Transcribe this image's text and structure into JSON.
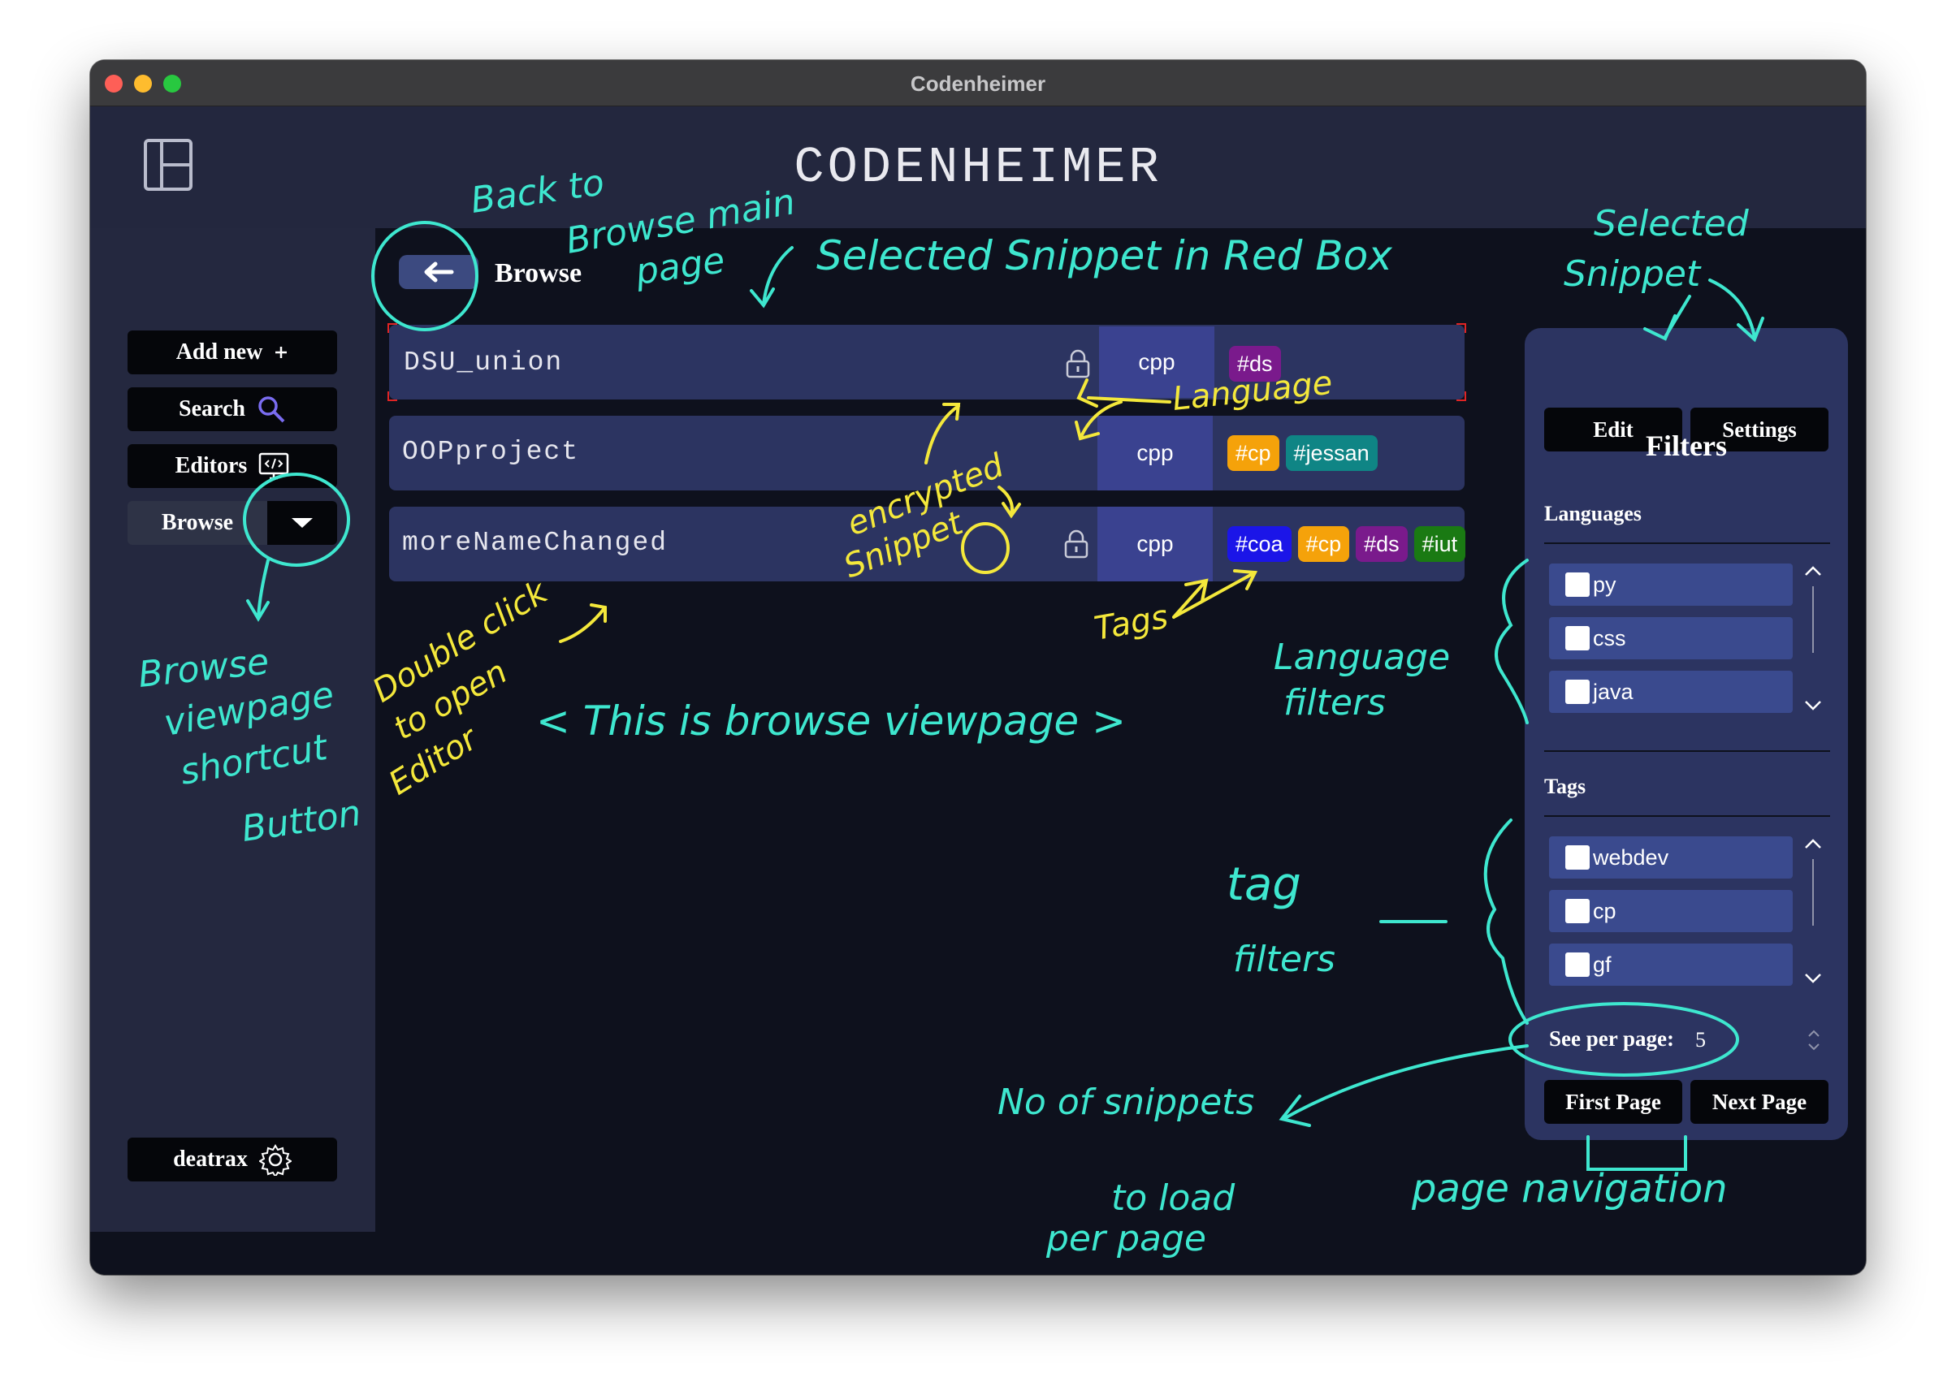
{
  "window": {
    "title": "Codenheimer"
  },
  "header": {
    "app_title": "CODENHEIMER"
  },
  "sidebar": {
    "add_new": "Add new",
    "search": "Search",
    "editors": "Editors",
    "browse": "Browse",
    "user": "deatrax"
  },
  "main": {
    "title": "Browse",
    "snippets": [
      {
        "name": "DSU_union",
        "language": "cpp",
        "encrypted": true,
        "tags": [
          "#ds"
        ]
      },
      {
        "name": "OOPproject",
        "language": "cpp",
        "encrypted": false,
        "tags": [
          "#cp",
          "#jessan"
        ]
      },
      {
        "name": "moreNameChanged",
        "language": "cpp",
        "encrypted": true,
        "tags": [
          "#coa",
          "#cp",
          "#ds",
          "#iut"
        ]
      }
    ]
  },
  "panel": {
    "edit": "Edit",
    "settings": "Settings",
    "filters_title": "Filters",
    "languages_title": "Languages",
    "languages": [
      "py",
      "css",
      "java"
    ],
    "tags_title": "Tags",
    "tags": [
      "webdev",
      "cp",
      "gf"
    ],
    "see_per_page_label": "See per page:",
    "see_per_page_value": "5",
    "first_page": "First Page",
    "next_page": "Next Page"
  },
  "colors": {
    "tag_ds": "#7a1a8c",
    "tag_cp": "#f5a20a",
    "tag_jessan": "#0f8585",
    "tag_coa": "#1b15e8",
    "tag_iut": "#1a7a13",
    "annotation_cyan": "#3ee7cf",
    "annotation_yellow": "#f4e83b"
  },
  "annotations": {
    "back": [
      "Back to",
      "Browse main",
      "page"
    ],
    "selected": "Selected Snippet in Red Box",
    "selected_snippet": [
      "Selected",
      "Snippet"
    ],
    "language": "Language",
    "encrypted": [
      "encrypted",
      "Snippet"
    ],
    "tags": "Tags",
    "double_click": [
      "Double click",
      "to open",
      "Editor"
    ],
    "browse_viewpage": "< This is browse viewpage >",
    "browse_shortcut": [
      "Browse",
      "viewpage",
      "shortcut",
      "Button"
    ],
    "language_filters": [
      "Language",
      "filters"
    ],
    "tag_filters": [
      "tag",
      "filters"
    ],
    "num_snippets": [
      "No of snippets",
      "to load",
      "per page"
    ],
    "page_nav": "page navigation"
  }
}
